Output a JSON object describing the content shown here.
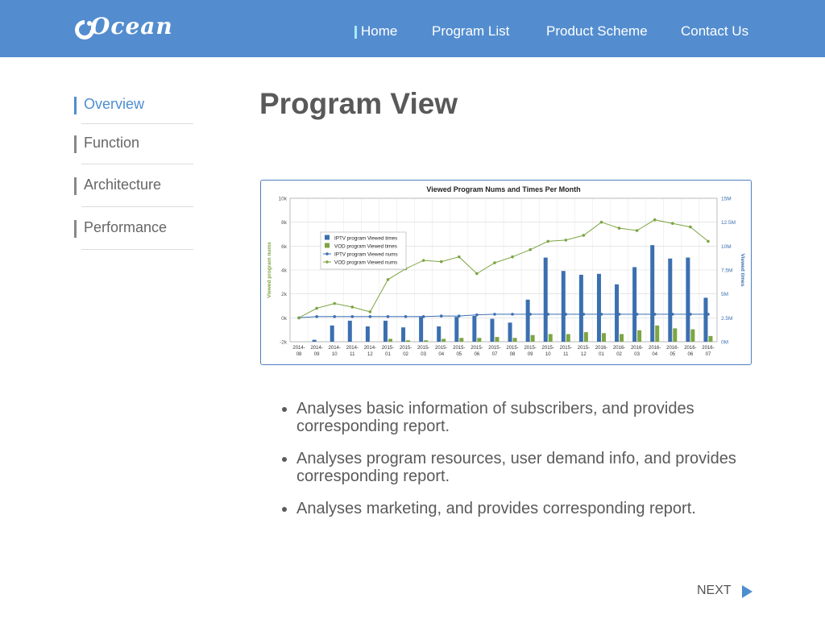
{
  "brand": {
    "logo_text": "Ocean",
    "header_color": "#538dcf"
  },
  "nav": {
    "items": [
      {
        "label": "Home"
      },
      {
        "label": "Program List"
      },
      {
        "label": "Product Scheme"
      },
      {
        "label": "Contact Us"
      }
    ],
    "active_index": 0
  },
  "sidebar": {
    "items": [
      {
        "label": "Overview"
      },
      {
        "label": "Function"
      },
      {
        "label": "Architecture"
      },
      {
        "label": "Performance"
      }
    ],
    "active_index": 0,
    "active_color": "#4d8ed0"
  },
  "page": {
    "title": "Program View"
  },
  "chart_data": {
    "type": "bar",
    "title": "Viewed Program Nums and Times Per Month",
    "ylabel": "Viewed program nums",
    "y2label": "Viewed times",
    "ylim": [
      -2000,
      10000
    ],
    "y_ticks": [
      "-2k",
      "0k",
      "2k",
      "4k",
      "6k",
      "8k",
      "10k"
    ],
    "y2lim": [
      0,
      15000000
    ],
    "y2_ticks": [
      "0M",
      "2.5M",
      "5M",
      "7.5M",
      "10M",
      "12.5M",
      "15M"
    ],
    "categories": [
      "2014-08",
      "2014-09",
      "2014-10",
      "2014-11",
      "2014-12",
      "2015-01",
      "2015-02",
      "2015-03",
      "2015-04",
      "2015-05",
      "2015-06",
      "2015-07",
      "2015-08",
      "2015-09",
      "2015-10",
      "2015-11",
      "2015-12",
      "2016-01",
      "2016-02",
      "2016-03",
      "2016-04",
      "2016-05",
      "2016-06",
      "2016-07"
    ],
    "grid": true,
    "legend_position": "top-left",
    "series": [
      {
        "name": "IPTV program Viewed times",
        "kind": "bar",
        "axis": "y2",
        "color": "#3b6fb0",
        "values": [
          0,
          200000,
          1700000,
          2200000,
          1600000,
          2200000,
          1500000,
          2600000,
          1600000,
          2600000,
          2700000,
          2400000,
          2000000,
          4400000,
          8800000,
          7400000,
          7000000,
          7100000,
          6000000,
          7800000,
          10100000,
          8700000,
          8800000,
          4600000
        ]
      },
      {
        "name": "VOD program Viewed times",
        "kind": "bar",
        "axis": "y2",
        "color": "#7da543",
        "values": [
          0,
          0,
          0,
          0,
          0,
          300000,
          150000,
          150000,
          300000,
          400000,
          400000,
          500000,
          400000,
          700000,
          800000,
          800000,
          1000000,
          900000,
          800000,
          1200000,
          1700000,
          1400000,
          1300000,
          600000
        ]
      },
      {
        "name": "IPTV program Viewed nums",
        "kind": "line",
        "axis": "y",
        "color": "#3b6fb0",
        "values": [
          0,
          100,
          100,
          100,
          100,
          100,
          100,
          100,
          150,
          150,
          250,
          300,
          300,
          300,
          300,
          300,
          300,
          300,
          300,
          300,
          300,
          300,
          300,
          300
        ]
      },
      {
        "name": "VOD program Viewed nums",
        "kind": "line",
        "axis": "y",
        "color": "#7da543",
        "values": [
          0,
          800,
          1200,
          900,
          500,
          3200,
          4100,
          4800,
          4700,
          5100,
          3700,
          4600,
          5100,
          5700,
          6400,
          6500,
          6900,
          8000,
          7500,
          7300,
          8200,
          7900,
          7600,
          6400
        ]
      }
    ]
  },
  "bullets": [
    "Analyses basic information of subscribers, and provides corresponding report.",
    "Analyses program resources, user demand info, and provides corresponding report.",
    "Analyses marketing, and provides corresponding report."
  ],
  "footer": {
    "next_label": "NEXT"
  }
}
